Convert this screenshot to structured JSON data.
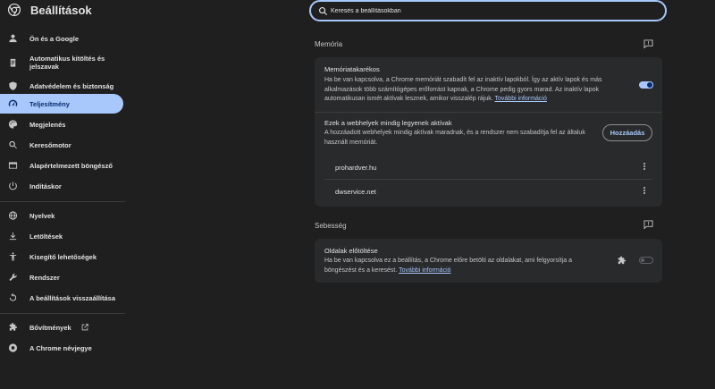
{
  "header": {
    "title": "Beállítások",
    "search_placeholder": "Keresés a beállításokban"
  },
  "sidebar": {
    "items": [
      {
        "label": "Ön és a Google",
        "icon": "person-icon"
      },
      {
        "label": "Automatikus kitöltés és jelszavak",
        "icon": "clipboard-icon"
      },
      {
        "label": "Adatvédelem és biztonság",
        "icon": "shield-icon"
      },
      {
        "label": "Teljesítmény",
        "icon": "speedometer-icon",
        "active": true
      },
      {
        "label": "Megjelenés",
        "icon": "palette-icon"
      },
      {
        "label": "Keresőmotor",
        "icon": "search-icon"
      },
      {
        "label": "Alapértelmezett böngésző",
        "icon": "browser-icon"
      },
      {
        "label": "Indításkor",
        "icon": "power-icon"
      },
      {
        "label": "Nyelvek",
        "icon": "globe-icon"
      },
      {
        "label": "Letöltések",
        "icon": "download-icon"
      },
      {
        "label": "Kisegítő lehetőségek",
        "icon": "accessibility-icon"
      },
      {
        "label": "Rendszer",
        "icon": "wrench-icon"
      },
      {
        "label": "A beállítások visszaállítása",
        "icon": "reset-icon"
      },
      {
        "label": "Bővítmények",
        "icon": "puzzle-icon"
      },
      {
        "label": "A Chrome névjegye",
        "icon": "chrome-icon"
      }
    ]
  },
  "memory": {
    "section_title": "Memória",
    "saver_title": "Memóriatakarékos",
    "saver_desc": "Ha be van kapcsolva, a Chrome memóriát szabadít fel az inaktív lapokból. Így az aktív lapok és más alkalmazások több számítógépes erőforrást kapnak, a Chrome pedig gyors marad. Az inaktív lapok automatikusan ismét aktívak lesznek, amikor visszalép rájuk.",
    "saver_link": "További információ",
    "saver_enabled": true,
    "always_active_title": "Ezek a webhelyek mindig legyenek aktívak",
    "always_active_desc": "A hozzáadott webhelyek mindig aktívak maradnak, és a rendszer nem szabadítja fel az általuk használt memóriát.",
    "add_button": "Hozzáadás",
    "sites": [
      "prohardver.hu",
      "dwservice.net"
    ]
  },
  "speed": {
    "section_title": "Sebesség",
    "preload_title": "Oldalak előtöltése",
    "preload_desc": "Ha be van kapcsolva ez a beállítás, a Chrome előre betölti az oldalakat, ami felgyorsítja a böngészést és a keresést.",
    "preload_link": "További információ",
    "preload_enabled": false
  },
  "colors": {
    "accent": "#a8c7fa",
    "background": "#1f1f1f",
    "card": "#282a2c"
  }
}
